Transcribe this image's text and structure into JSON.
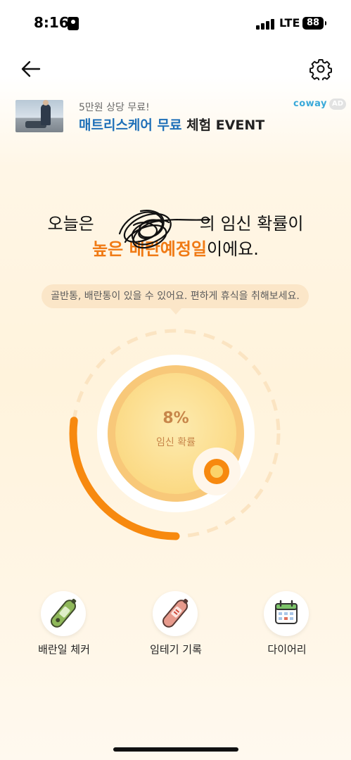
{
  "status": {
    "time": "8:16",
    "network": "LTE",
    "battery": "88"
  },
  "ad": {
    "subtitle": "5만원 상당 무료!",
    "title_highlight": "매트리스케어 무료",
    "title_rest": " 체험 EVENT",
    "brand": "coway",
    "badge": "AD"
  },
  "headline": {
    "line1_start": "오늘은",
    "line1_end": "의 임신 확률이",
    "line2_highlight": "높은 배란예정일",
    "line2_end": "이에요."
  },
  "tip": "골반통, 배란통이 있을 수 있어요. 편하게 휴식을 취해보세요.",
  "gauge": {
    "value": "8%",
    "label": "임신 확률",
    "cycle_progress": 0.27
  },
  "actions": [
    {
      "label": "배란일 체커",
      "icon": "ovulation-thermometer-icon"
    },
    {
      "label": "임테기 기록",
      "icon": "pregnancy-test-icon"
    },
    {
      "label": "다이어리",
      "icon": "calendar-icon"
    }
  ],
  "colors": {
    "accent": "#f07a14",
    "ad_blue": "#1f70b8",
    "brand": "#39a9d9",
    "gauge_text": "#c7864a"
  }
}
